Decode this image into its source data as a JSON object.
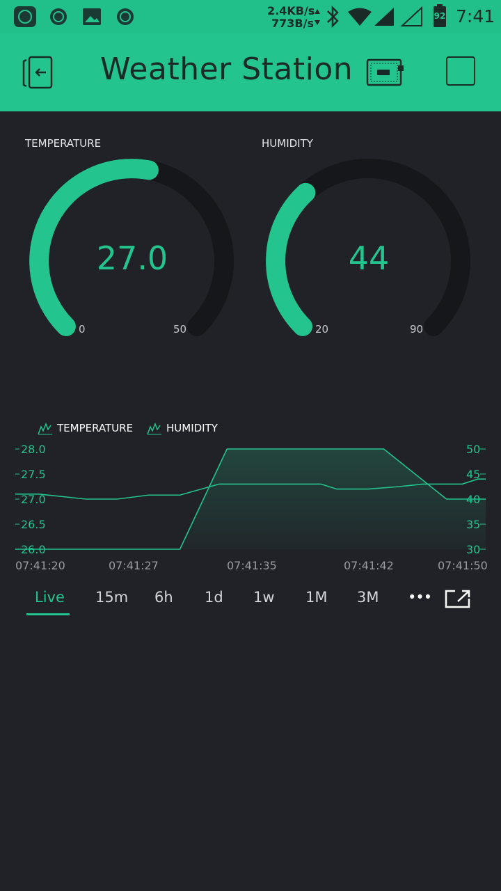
{
  "status_bar": {
    "speed_up": "2.4KB/s",
    "speed_down": "773B/s",
    "battery": "92",
    "time": "7:41"
  },
  "app_bar": {
    "title": "Weather Station",
    "back_icon": "exit-icon",
    "device_icon": "device-board-icon",
    "menu_icon": "square-icon"
  },
  "gauges": [
    {
      "label": "TEMPERATURE",
      "value": "27.0",
      "min": "0",
      "max": "50",
      "level": 0.54
    },
    {
      "label": "HUMIDITY",
      "value": "44",
      "min": "20",
      "max": "90",
      "level": 0.343
    }
  ],
  "chart_data": {
    "type": "line",
    "legend": [
      "TEMPERATURE",
      "HUMIDITY"
    ],
    "x_ticks": [
      "07:41:20",
      "07:41:27",
      "07:41:35",
      "07:41:42",
      "07:41:50"
    ],
    "y_left_ticks": [
      "28.0",
      "27.5",
      "27.0",
      "26.5",
      "26.0"
    ],
    "y_right_ticks": [
      "50",
      "45",
      "40",
      "35",
      "30"
    ],
    "y_left_range": [
      26.0,
      28.0
    ],
    "y_right_range": [
      30,
      50
    ],
    "series": [
      {
        "name": "TEMPERATURE",
        "axis": "left",
        "x_seconds_offset": [
          0,
          10.5,
          13.5,
          23.5,
          27.5,
          30
        ],
        "values": [
          26.0,
          26.0,
          28.0,
          28.0,
          27.0,
          27.0
        ]
      },
      {
        "name": "HUMIDITY",
        "axis": "right",
        "x_seconds_offset": [
          0,
          1.5,
          4.5,
          6.5,
          8.5,
          10.5,
          13,
          19.5,
          20.5,
          22.5,
          24.5,
          26.0,
          28.5,
          29.5,
          30
        ],
        "values": [
          41,
          41,
          40,
          40,
          40.8,
          40.8,
          43,
          43,
          42,
          42,
          42.5,
          43,
          43,
          44,
          44
        ]
      }
    ]
  },
  "range_tabs": [
    "Live",
    "15m",
    "6h",
    "1d",
    "1w",
    "1M",
    "3M"
  ],
  "more_label": "•••",
  "accent": "#23c48e",
  "background": "#212227"
}
